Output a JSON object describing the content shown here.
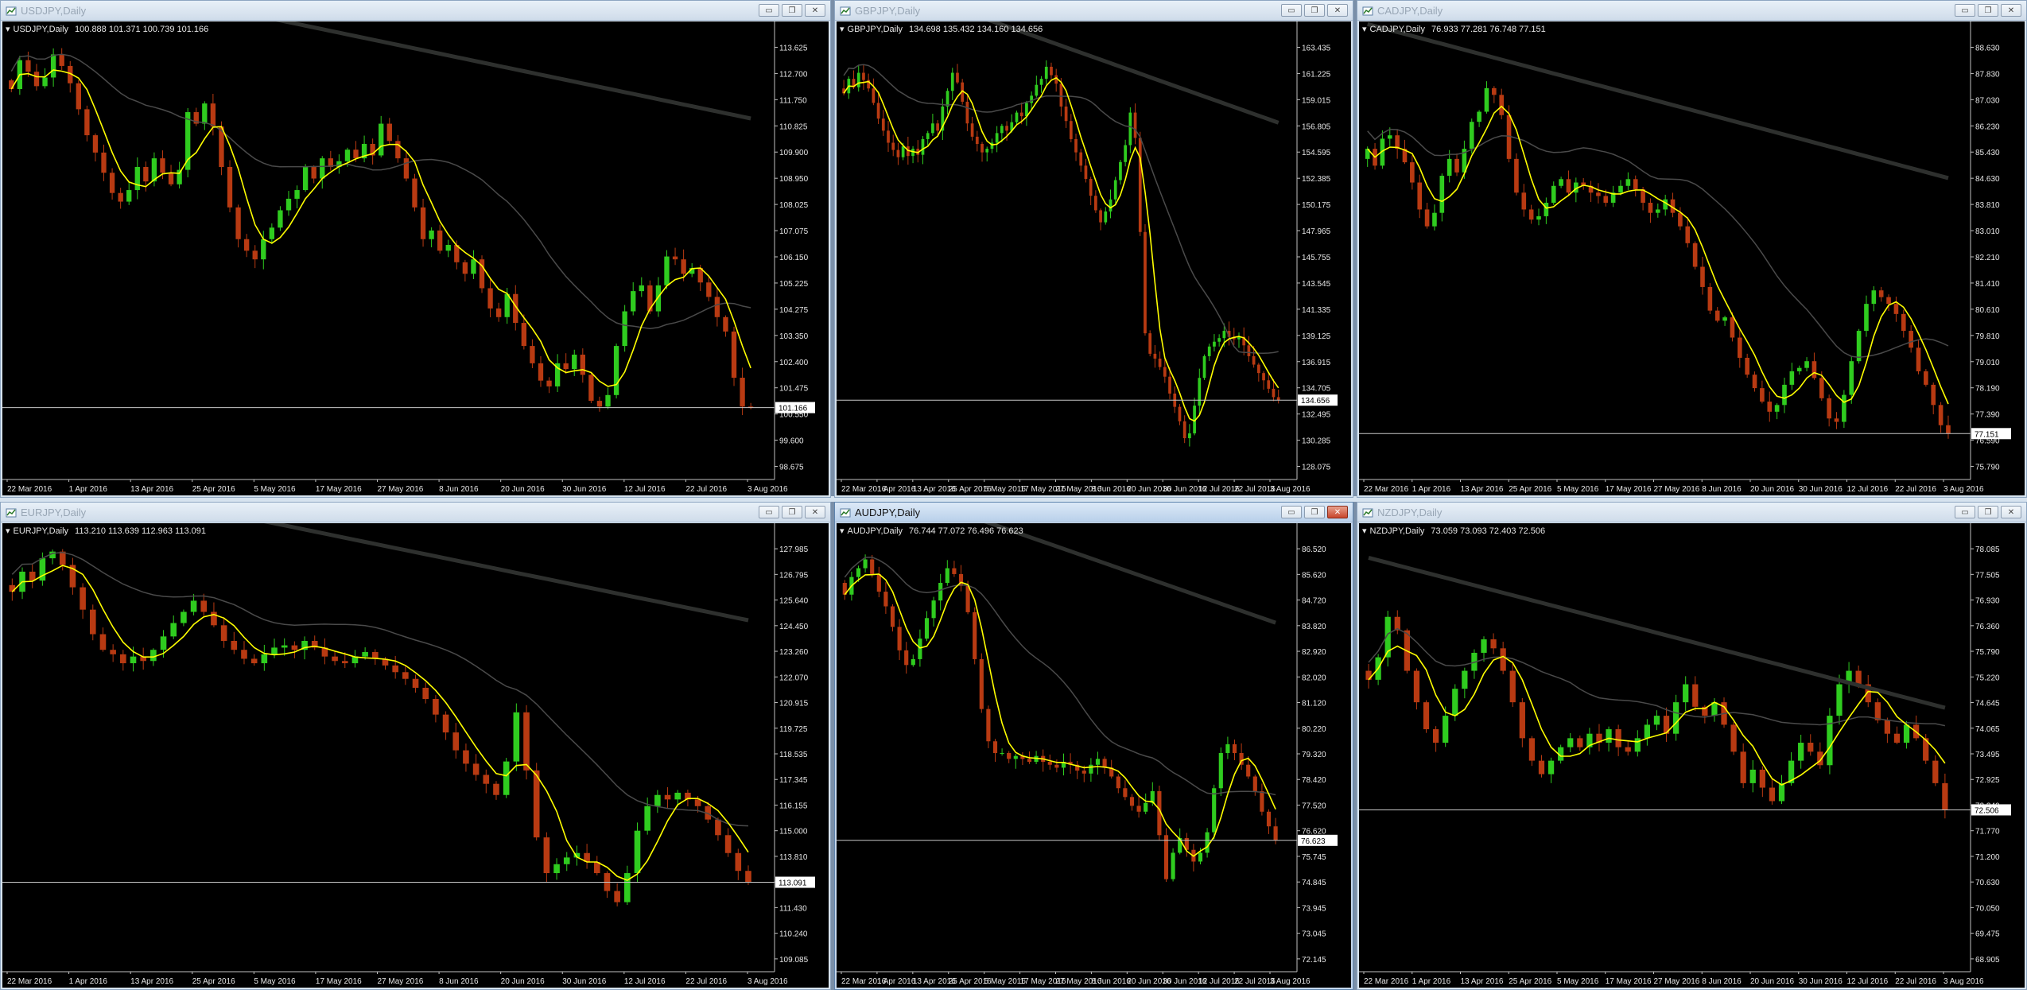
{
  "colors": {
    "background": "#000000",
    "bull": "#2fcc1f",
    "bear": "#b83a12",
    "ma_fast": "#ffff00",
    "ma_mid": "#4a4a4a",
    "ma_slow": "#2e302e",
    "axis_text": "#e6e6e6",
    "price_line": "#c8c8c8"
  },
  "x_axis_labels": [
    "22 Mar 2016",
    "1 Apr 2016",
    "13 Apr 2016",
    "25 Apr 2016",
    "5 May 2016",
    "17 May 2016",
    "27 May 2016",
    "8 Jun 2016",
    "20 Jun 2016",
    "30 Jun 2016",
    "12 Jul 2016",
    "22 Jul 2016",
    "3 Aug 2016"
  ],
  "windows": [
    {
      "title": "USDJPY,Daily",
      "symbol_label": "USDJPY,Daily",
      "ohlc": "100.888 101.371 100.739 101.166",
      "current_price": "101.166",
      "active": false,
      "y_ticks": [
        "113.625",
        "112.700",
        "111.750",
        "110.825",
        "109.900",
        "108.950",
        "108.025",
        "107.075",
        "106.150",
        "105.225",
        "104.275",
        "103.350",
        "102.400",
        "101.475",
        "100.550",
        "99.600",
        "98.675"
      ],
      "icons": [
        "chart-window-icon",
        "minimize-icon",
        "restore-icon",
        "close-icon"
      ],
      "chart_data": {
        "type": "candlestick",
        "symbol": "USDJPY",
        "timeframe": "Daily",
        "ylim": [
          98.675,
          114.1
        ],
        "last": 101.166,
        "path": [
          112.5,
          112.2,
          113.2,
          112.8,
          112.3,
          112.6,
          113.4,
          113.0,
          112.4,
          111.5,
          110.6,
          110.0,
          109.3,
          108.6,
          108.3,
          108.7,
          109.5,
          109.0,
          109.8,
          109.3,
          108.9,
          109.4,
          111.4,
          111.0,
          111.7,
          110.9,
          109.5,
          108.1,
          107.0,
          106.6,
          106.3,
          107.0,
          107.4,
          108.0,
          108.4,
          108.7,
          109.5,
          109.1,
          109.8,
          109.5,
          109.7,
          110.1,
          109.8,
          110.3,
          109.9,
          111.0,
          110.4,
          109.8,
          109.1,
          108.1,
          107.0,
          107.3,
          106.6,
          106.8,
          106.2,
          105.8,
          106.3,
          105.3,
          104.6,
          104.3,
          105.1,
          104.1,
          103.3,
          102.7,
          102.1,
          101.9,
          102.7,
          102.5,
          103.0,
          102.3,
          101.4,
          101.2,
          101.6,
          103.3,
          104.5,
          105.2,
          105.4,
          104.5,
          105.4,
          106.4,
          106.3,
          105.8,
          106.0,
          105.5,
          105.0,
          104.3,
          103.8,
          102.2,
          101.2,
          101.17
        ]
      }
    },
    {
      "title": "GBPJPY,Daily",
      "symbol_label": "GBPJPY,Daily",
      "ohlc": "134.698 135.432 134.160 134.656",
      "current_price": "134.656",
      "active": false,
      "y_ticks": [
        "163.435",
        "161.225",
        "159.015",
        "156.805",
        "154.595",
        "152.385",
        "150.175",
        "147.965",
        "145.755",
        "143.545",
        "141.335",
        "139.125",
        "136.915",
        "134.705",
        "132.495",
        "130.285",
        "128.075"
      ],
      "icons": [
        "chart-window-icon",
        "minimize-icon",
        "restore-icon",
        "close-icon"
      ],
      "chart_data": {
        "type": "candlestick",
        "symbol": "GBPJPY",
        "timeframe": "Daily",
        "ylim": [
          128.075,
          165.0
        ],
        "last": 134.656,
        "path": [
          160.5,
          160.1,
          161.3,
          160.6,
          161.8,
          161.2,
          160.5,
          159.3,
          158.0,
          157.0,
          156.0,
          155.4,
          154.8,
          155.7,
          154.9,
          155.5,
          155.0,
          156.3,
          156.8,
          157.6,
          157.0,
          159.0,
          160.3,
          161.8,
          161.0,
          159.4,
          157.6,
          156.5,
          155.9,
          155.2,
          155.5,
          156.0,
          156.8,
          157.4,
          157.0,
          157.7,
          158.5,
          158.2,
          159.3,
          159.9,
          160.8,
          161.3,
          162.3,
          161.6,
          160.9,
          159.0,
          157.8,
          156.3,
          155.2,
          154.1,
          153.0,
          151.6,
          150.4,
          149.4,
          150.3,
          151.3,
          152.9,
          154.4,
          155.8,
          158.5,
          156.4,
          148.6,
          140.2,
          138.5,
          138.1,
          137.4,
          136.6,
          135.2,
          134.1,
          132.9,
          131.5,
          131.9,
          134.2,
          136.5,
          138.3,
          139.1,
          139.5,
          139.8,
          140.4,
          139.9,
          139.7,
          139.9,
          139.2,
          138.3,
          137.6,
          136.9,
          136.3,
          135.6,
          134.9,
          134.66
        ]
      }
    },
    {
      "title": "CADJPY,Daily",
      "symbol_label": "CADJPY,Daily",
      "ohlc": "76.933 77.281 76.748 77.151",
      "current_price": "77.151",
      "active": false,
      "y_ticks": [
        "88.630",
        "87.830",
        "87.030",
        "86.230",
        "85.430",
        "84.630",
        "83.810",
        "83.010",
        "82.210",
        "81.410",
        "80.610",
        "79.810",
        "79.010",
        "78.190",
        "77.390",
        "76.590",
        "75.790"
      ],
      "icons": [
        "chart-window-icon",
        "minimize-icon",
        "restore-icon",
        "close-icon"
      ],
      "chart_data": {
        "type": "candlestick",
        "symbol": "CADJPY",
        "timeframe": "Daily",
        "ylim": [
          75.79,
          89.0
        ],
        "last": 77.151,
        "path": [
          85.3,
          85.6,
          85.1,
          85.9,
          86.0,
          85.6,
          85.2,
          84.6,
          83.8,
          83.3,
          83.7,
          84.8,
          85.3,
          84.9,
          85.6,
          86.4,
          86.7,
          87.4,
          87.2,
          86.6,
          85.3,
          84.3,
          83.8,
          83.5,
          83.6,
          84.0,
          84.5,
          84.7,
          84.3,
          84.6,
          84.5,
          84.3,
          84.2,
          84.0,
          84.3,
          84.5,
          84.7,
          84.4,
          84.0,
          83.7,
          83.8,
          84.1,
          83.7,
          83.3,
          82.8,
          82.1,
          81.5,
          80.8,
          80.5,
          80.6,
          80.0,
          79.4,
          78.9,
          78.5,
          78.1,
          77.8,
          78.0,
          78.6,
          79.0,
          79.1,
          79.3,
          78.8,
          78.2,
          77.6,
          77.5,
          78.3,
          79.3,
          80.2,
          81.0,
          81.4,
          81.2,
          81.0,
          80.7,
          80.2,
          79.7,
          79.0,
          78.6,
          78.0,
          77.4,
          77.15
        ]
      }
    },
    {
      "title": "EURJPY,Daily",
      "symbol_label": "EURJPY,Daily",
      "ohlc": "113.210 113.639 112.963 113.091",
      "current_price": "113.091",
      "active": false,
      "y_ticks": [
        "127.985",
        "126.795",
        "125.640",
        "124.450",
        "123.260",
        "122.070",
        "120.915",
        "119.725",
        "118.535",
        "117.345",
        "116.155",
        "115.000",
        "113.810",
        "112.620",
        "111.430",
        "110.240",
        "109.085"
      ],
      "icons": [
        "chart-window-icon",
        "minimize-icon",
        "restore-icon",
        "close-icon"
      ],
      "chart_data": {
        "type": "candlestick",
        "symbol": "EURJPY",
        "timeframe": "Daily",
        "ylim": [
          109.085,
          128.6
        ],
        "last": 113.091,
        "path": [
          126.4,
          126.1,
          127.0,
          126.6,
          127.6,
          127.9,
          127.3,
          126.3,
          125.3,
          124.2,
          123.5,
          123.3,
          122.9,
          123.2,
          123.0,
          123.5,
          124.1,
          124.7,
          125.2,
          125.7,
          125.2,
          124.6,
          123.9,
          123.5,
          123.1,
          122.9,
          123.3,
          123.6,
          123.7,
          123.5,
          123.9,
          123.6,
          123.2,
          123.0,
          122.9,
          123.2,
          123.4,
          123.1,
          122.8,
          122.5,
          122.2,
          121.8,
          121.3,
          120.6,
          119.8,
          119.0,
          118.4,
          117.9,
          117.5,
          117.0,
          118.5,
          120.7,
          118.1,
          115.1,
          113.5,
          113.9,
          114.2,
          114.4,
          114.0,
          113.5,
          112.7,
          112.2,
          113.5,
          115.4,
          116.5,
          117.0,
          116.8,
          117.1,
          116.8,
          116.5,
          115.9,
          115.2,
          114.4,
          113.6,
          113.09
        ]
      }
    },
    {
      "title": "AUDJPY,Daily",
      "symbol_label": "AUDJPY,Daily",
      "ohlc": "76.744 77.072 76.496 76.623",
      "current_price": "76.623",
      "active": true,
      "y_ticks": [
        "86.520",
        "85.620",
        "84.720",
        "83.820",
        "82.920",
        "82.020",
        "81.120",
        "80.220",
        "79.320",
        "78.420",
        "77.520",
        "76.620",
        "75.745",
        "74.845",
        "73.945",
        "73.045",
        "72.145"
      ],
      "icons": [
        "chart-window-icon",
        "minimize-icon",
        "restore-icon",
        "close-icon"
      ],
      "chart_data": {
        "type": "candlestick",
        "symbol": "AUDJPY",
        "timeframe": "Daily",
        "ylim": [
          72.145,
          87.0
        ],
        "last": 76.623,
        "path": [
          85.4,
          85.0,
          85.6,
          85.9,
          86.2,
          85.7,
          85.1,
          84.6,
          83.9,
          83.1,
          82.6,
          82.8,
          83.5,
          84.2,
          84.8,
          85.4,
          85.9,
          85.7,
          85.3,
          84.4,
          82.8,
          81.1,
          80.0,
          79.6,
          79.6,
          79.4,
          79.5,
          79.4,
          79.3,
          79.5,
          79.3,
          79.2,
          79.1,
          79.3,
          79.2,
          79.0,
          78.9,
          79.2,
          79.4,
          79.1,
          78.8,
          78.4,
          78.1,
          77.8,
          77.6,
          77.9,
          78.3,
          76.8,
          75.3,
          76.2,
          76.7,
          76.3,
          75.9,
          76.2,
          76.9,
          78.4,
          79.6,
          79.9,
          79.6,
          79.2,
          78.8,
          78.3,
          77.6,
          77.1,
          76.62
        ]
      }
    },
    {
      "title": "NZDJPY,Daily",
      "symbol_label": "NZDJPY,Daily",
      "ohlc": "73.059 73.093 72.403 72.506",
      "current_price": "72.506",
      "active": false,
      "y_ticks": [
        "78.085",
        "77.505",
        "76.930",
        "76.360",
        "75.790",
        "75.220",
        "74.645",
        "74.065",
        "73.495",
        "72.925",
        "72.340",
        "71.770",
        "71.200",
        "70.630",
        "70.050",
        "69.475",
        "68.905"
      ],
      "icons": [
        "chart-window-icon",
        "minimize-icon",
        "restore-icon",
        "close-icon"
      ],
      "chart_data": {
        "type": "candlestick",
        "symbol": "NZDJPY",
        "timeframe": "Daily",
        "ylim": [
          68.905,
          78.6
        ],
        "last": 72.506,
        "path": [
          75.6,
          75.4,
          75.9,
          76.8,
          76.5,
          75.6,
          74.9,
          74.3,
          74.0,
          74.6,
          75.2,
          75.6,
          76.0,
          76.3,
          76.1,
          75.6,
          74.9,
          74.1,
          73.6,
          73.3,
          73.6,
          73.9,
          74.1,
          73.9,
          74.2,
          74.0,
          74.3,
          73.9,
          73.8,
          74.1,
          74.4,
          74.6,
          74.2,
          74.9,
          75.3,
          74.8,
          74.6,
          74.9,
          74.4,
          73.8,
          73.1,
          73.4,
          73.0,
          72.7,
          73.1,
          73.6,
          74.0,
          73.8,
          73.5,
          74.6,
          75.3,
          75.6,
          75.3,
          74.9,
          74.5,
          74.2,
          74.0,
          74.4,
          74.1,
          73.6,
          73.1,
          72.51
        ]
      }
    }
  ]
}
